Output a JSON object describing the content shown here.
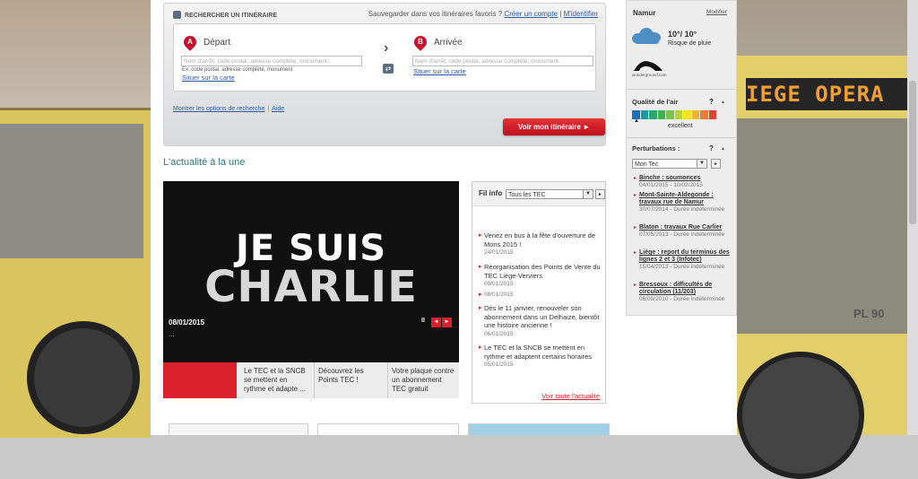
{
  "background": {
    "led_sign": "IEGE OPERA",
    "bus_number": "PL 90"
  },
  "planner": {
    "title": "RECHERCHER UN ITINÉRAIRE",
    "save_text": "Sauvegarder dans vos itinéraires favoris ?",
    "create_account": "Créer un compte",
    "identify": "M'identifier",
    "from": {
      "letter": "A",
      "label": "Départ",
      "placeholder": "Nom d'arrêt, code postal, adresse complète, monument...",
      "hint": "Ex: code postal, adresse complète, monument",
      "map_link": "Situer sur la carte"
    },
    "to": {
      "letter": "B",
      "label": "Arrivée",
      "placeholder": "Nom d'arrêt, code postal, adresse complète, monument...",
      "map_link": "Situer sur la carte"
    },
    "swap_glyph": "⇄",
    "options_link": "Montrer les options de recherche",
    "separator": "|",
    "help_link": "Aide",
    "submit": "Voir mon itinéraire ►"
  },
  "section_title": "L'actualité à la une",
  "hero": {
    "line1": "JE SUIS",
    "line2": "CHARLIE",
    "date": "08/01/2015",
    "ellipsis": "...",
    "pause": "II",
    "prev": "◄",
    "next": "►"
  },
  "tabs": [
    {
      "label": ""
    },
    {
      "label": "Le TEC et la SNCB se mettent en rythme et adapte ..."
    },
    {
      "label": "Découvrez les Points TEC !"
    },
    {
      "label": "Votre plaque contre un abonnement TEC gratuit"
    }
  ],
  "newsfeed": {
    "label": "Fil info",
    "filter": "Tous les TEC",
    "dropdown_glyph": "▼",
    "go_glyph": "►",
    "items": [
      {
        "text": "Venez en bus à la fête d'ouverture de Mons 2015 !",
        "date": "24/01/2015"
      },
      {
        "text": "Réorganisation des Points de Vente du TEC Liège-Verviers",
        "date": "09/01/2015"
      },
      {
        "text": "",
        "date": "08/01/2015"
      },
      {
        "text": "Dès le 11 janvier, renouveler son abonnement dans un Delhaize, bientôt une histoire ancienne !",
        "date": "06/01/2015"
      },
      {
        "text": "Le TEC et la SNCB se mettent en rythme et adaptent certains horaires",
        "date": "05/01/2015"
      }
    ],
    "more": "Voir toute l'actualité"
  },
  "sidebar": {
    "city": "Namur",
    "modify": "Modifier",
    "temp": "10°/ 10°",
    "weather": "Risque de pluie",
    "provider": "wunderground.com",
    "air_title": "Qualité de l'air",
    "air_level": "excellent",
    "air_scale_colors": [
      "#1d6fb8",
      "#1a9b9b",
      "#2aa86a",
      "#3db34a",
      "#7cc242",
      "#b7d433",
      "#f2e422",
      "#f7b32b",
      "#f07a2a",
      "#e2412a"
    ],
    "help": "?",
    "collapse": "▲",
    "pert_title": "Perturbations :",
    "pert_filter": "Mon Tec",
    "pert_dd": "▼",
    "pert_go": "►",
    "disruptions": [
      {
        "title": "Binche : soumonces",
        "date": "04/01/2015 - 10/02/2015"
      },
      {
        "title": "Mont-Sainte-Aldegonde : travaux rue de Namur",
        "date": "30/07/2014 - Durée indéterminée"
      },
      {
        "title": "Blaton : travaux Rue Carlier",
        "date": "07/05/2013 - Durée indéterminée"
      },
      {
        "title": "Liège : report du terminus des lignes 2 et 3 (Infotec)",
        "date": "15/04/2013 - Durée indéterminée"
      },
      {
        "title": "Bressoux : difficultés de circulation (11/203)",
        "date": "06/09/2010 - Durée indéterminée"
      }
    ]
  }
}
